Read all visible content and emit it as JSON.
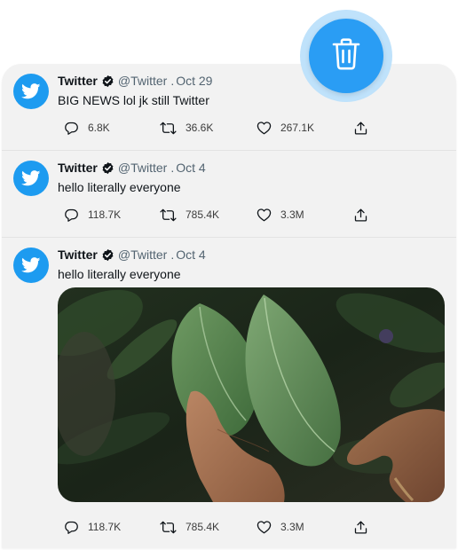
{
  "tweets": [
    {
      "name": "Twitter",
      "handle": "@Twitter",
      "dot": ".",
      "date": "Oct 29",
      "text": "BIG NEWS lol jk still Twitter",
      "replies": "6.8K",
      "retweets": "36.6K",
      "likes": "267.1K"
    },
    {
      "name": "Twitter",
      "handle": "@Twitter",
      "dot": ".",
      "date": "Oct 4",
      "text": "hello literally everyone",
      "replies": "118.7K",
      "retweets": "785.4K",
      "likes": "3.3M"
    },
    {
      "name": "Twitter",
      "handle": "@Twitter",
      "dot": ".",
      "date": "Oct 4",
      "text": "hello literally everyone",
      "replies": "118.7K",
      "retweets": "785.4K",
      "likes": "3.3M",
      "image_icon": "leaf-photo"
    }
  ],
  "icons": {
    "delete": "trash-icon",
    "avatar": "twitter-bird-icon",
    "verified": "verified-badge-icon",
    "reply": "reply-icon",
    "retweet": "retweet-icon",
    "like": "heart-icon",
    "share": "share-icon"
  },
  "colors": {
    "brand": "#1d9bf0",
    "delete_button": "#2a9df4",
    "delete_ring": "#bfe2fb",
    "card_bg": "#f2f2f2"
  }
}
